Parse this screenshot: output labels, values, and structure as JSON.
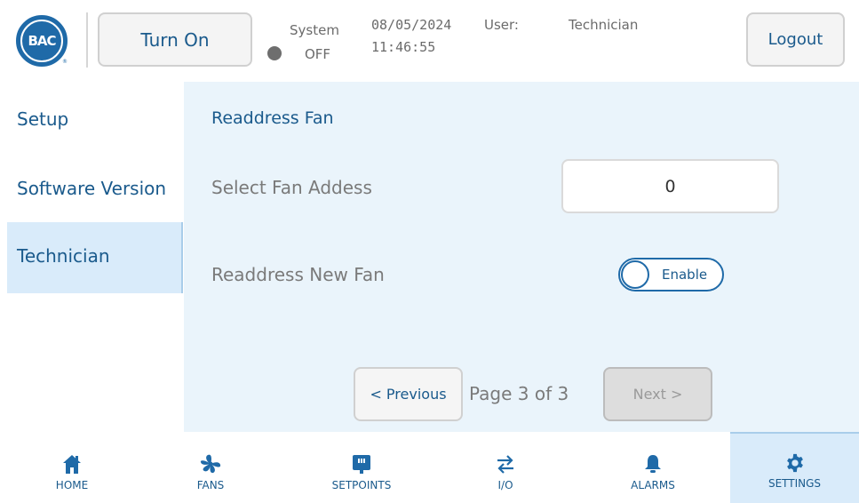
{
  "header": {
    "logo_text": "BAC",
    "logo_registered": "®",
    "turn_on_label": "Turn On",
    "system_label": "System",
    "system_state": "OFF",
    "date": "08/05/2024",
    "time": "11:46:55",
    "user_label": "User:",
    "user_value": "Technician",
    "logout_label": "Logout",
    "status_dot_color": "#6e6e6e"
  },
  "sidebar": {
    "items": [
      {
        "label": "Setup"
      },
      {
        "label": "Software Version"
      },
      {
        "label": "Technician",
        "active": true
      }
    ]
  },
  "main": {
    "title": "Readdress Fan",
    "select_label": "Select Fan Addess",
    "select_value": "0",
    "readdress_label": "Readdress New Fan",
    "toggle_label": "Enable",
    "previous_label": "< Previous",
    "page_info": "Page 3 of 3",
    "next_label": "Next >"
  },
  "nav": {
    "items": [
      {
        "label": "HOME",
        "icon": "home-icon"
      },
      {
        "label": "FANS",
        "icon": "fan-icon"
      },
      {
        "label": "SETPOINTS",
        "icon": "setpoints-icon"
      },
      {
        "label": "I/O",
        "icon": "io-arrows-icon"
      },
      {
        "label": "ALARMS",
        "icon": "bell-icon"
      },
      {
        "label": "SETTINGS",
        "icon": "gear-icon",
        "active": true
      }
    ]
  },
  "colors": {
    "brand": "#1f6aa8",
    "text_primary": "#1a5a8c",
    "panel_bg": "#eaf4fb",
    "active_bg": "#d9ebfa"
  }
}
